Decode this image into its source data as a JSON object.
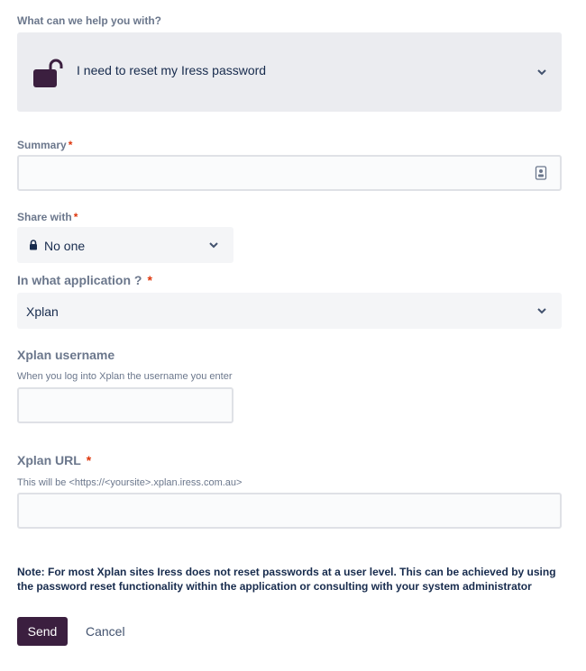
{
  "request_type": {
    "label": "What can we help you with?",
    "value": "I need to reset my Iress password",
    "icon": "unlocked-padlock-icon"
  },
  "summary": {
    "label": "Summary",
    "required_mark": "*",
    "value": "",
    "icon": "contact-card-icon"
  },
  "share_with": {
    "label": "Share with",
    "required_mark": "*",
    "value": "No one",
    "icon": "lock-icon"
  },
  "application": {
    "label": "In what application ?",
    "required_mark": "*",
    "value": "Xplan"
  },
  "username": {
    "label": "Xplan username",
    "help": "When you log into Xplan the username you enter",
    "value": ""
  },
  "url": {
    "label": "Xplan URL",
    "required_mark": "*",
    "help": "This will be <https://<yoursite>.xplan.iress.com.au>",
    "value": ""
  },
  "note": "Note: For most Xplan sites Iress does not reset passwords at a user level. This can be achieved by using the password reset functionality within the application or consulting with your system administrator",
  "actions": {
    "send": "Send",
    "cancel": "Cancel"
  },
  "colors": {
    "brand": "#3b1f3f",
    "required": "#de350b",
    "label": "#6b778c"
  }
}
